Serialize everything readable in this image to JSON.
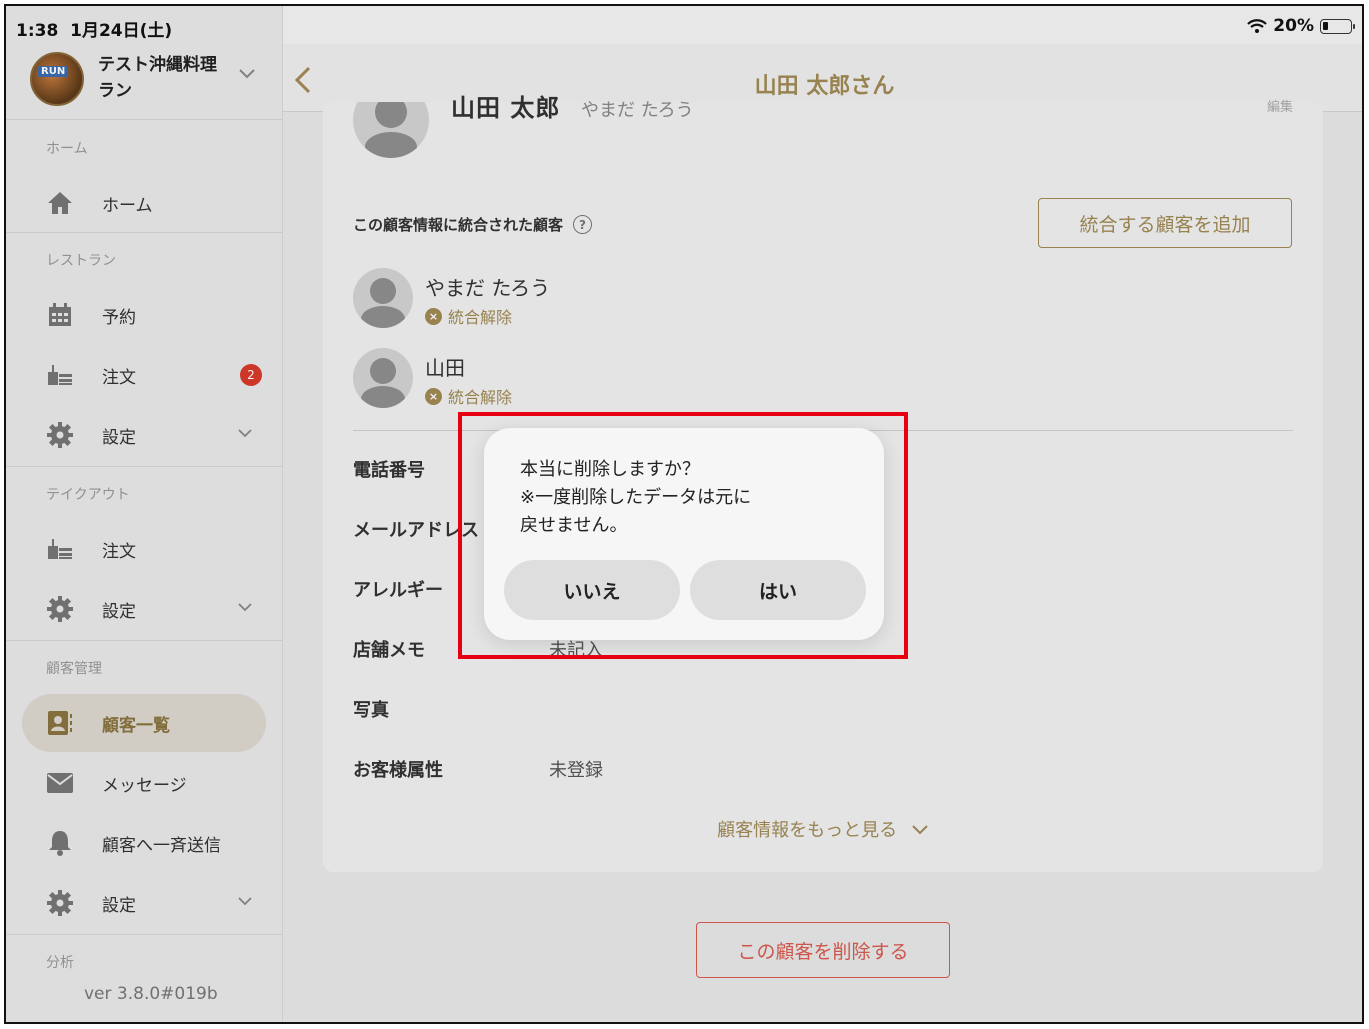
{
  "status": {
    "time": "1:38",
    "date": "1月24日(土)",
    "battery": "20%"
  },
  "store": {
    "name": "テスト沖縄料理ラン",
    "avatar_text": "RUN"
  },
  "sidebar": {
    "sections": {
      "home": "ホーム",
      "restaurant": "レストラン",
      "takeout": "テイクアウト",
      "customer": "顧客管理",
      "analytics": "分析"
    },
    "items": {
      "home": "ホーム",
      "reservation": "予約",
      "order": "注文",
      "order_badge": "2",
      "restaurant_settings": "設定",
      "takeout_order": "注文",
      "takeout_settings": "設定",
      "customer_list": "顧客一覧",
      "message": "メッセージ",
      "broadcast": "顧客へ一斉送信",
      "customer_settings": "設定"
    },
    "version": "ver 3.8.0#019b"
  },
  "header": {
    "title": "山田 太郎さん"
  },
  "customer": {
    "name_cut": "山田 太郎",
    "kana_cut": "やまだ たろう",
    "edit_cut": "編集",
    "merged_label": "この顧客情報に統合された顧客",
    "merged_help": "?",
    "add_merge_button": "統合する顧客を追加",
    "merged": [
      {
        "name": "やまだ たろう",
        "unmerge": "統合解除"
      },
      {
        "name": "山田",
        "unmerge": "統合解除"
      }
    ],
    "fields": {
      "phone": "電話番号",
      "email": "メールアドレス",
      "allergy": "アレルギー",
      "memo": "店舗メモ",
      "memo_value": "未記入",
      "photo": "写真",
      "attribute": "お客様属性",
      "attribute_value": "未登録"
    },
    "more": "顧客情報をもっと見る",
    "delete_button": "この顧客を削除する"
  },
  "dialog": {
    "line1": "本当に削除しますか？",
    "line2": "※一度削除したデータは元に",
    "line3": "戻せません。",
    "no": "いいえ",
    "yes": "はい"
  }
}
